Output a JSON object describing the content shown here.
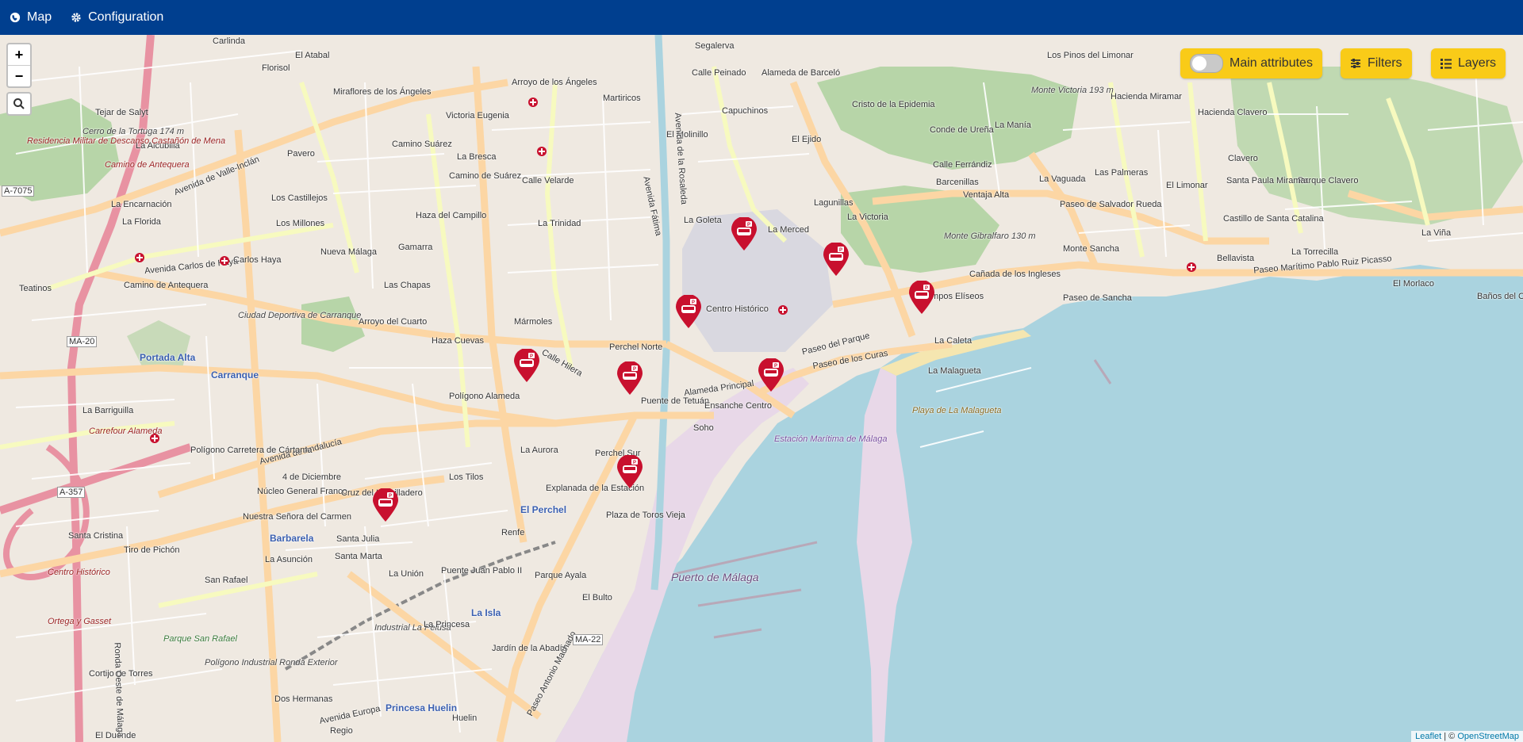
{
  "nav": {
    "map_label": "Map",
    "configuration_label": "Configuration"
  },
  "controls": {
    "main_attributes_label": "Main attributes",
    "filters_label": "Filters",
    "layers_label": "Layers",
    "zoom_in": "+",
    "zoom_out": "−"
  },
  "attribution": {
    "leaflet": "Leaflet",
    "separator": " | © ",
    "osm": "OpenStreetMap"
  },
  "colors": {
    "topbar": "#003f8f",
    "control_bg": "#f9cb18",
    "marker": "#c8102e",
    "sea": "#aad3df",
    "park": "#add19e"
  },
  "map_labels": {
    "carlinda": "Carlinda",
    "florisol": "Florisol",
    "el_atabal": "El Atabal",
    "miraflores": "Miraflores de los Ángeles",
    "arroyo_angeles": "Arroyo de los Ángeles",
    "martiricos": "Martiricos",
    "segalerva": "Segalerva",
    "calle_peinado": "Calle Peinado",
    "alameda_barcelo": "Alameda de Barceló",
    "los_pinos": "Los Pinos del Limonar",
    "monte_victoria": "Monte Victoria 193 m",
    "hacienda_miramar": "Hacienda Miramar",
    "hacienda_clavero": "Hacienda Clavero",
    "tejar_salyt": "Tejar de Salyt",
    "cerro_tortuga": "Cerro de la Tortuga 174 m",
    "la_alcubilla": "La Alcubilla",
    "pavero": "Pavero",
    "victoria_eugenia": "Victoria Eugenia",
    "la_bresca": "La Bresca",
    "el_molinillo": "El Molinillo",
    "capuchinos": "Capuchinos",
    "cristo_epidemia": "Cristo de la Epidemia",
    "conde_urena": "Conde de Ureña",
    "la_mania": "La Manía",
    "residencia_militar": "Residencia Militar de Descanso Castañón de Mena",
    "camino_antequera": "Camino de Antequera",
    "camino_suarez": "Camino Suárez",
    "el_ejido": "El Ejido",
    "calle_ferrandiz": "Calle Ferrándiz",
    "barcenillas": "Barcenillas",
    "la_vaguada": "La Vaguada",
    "las_palmeras": "Las Palmeras",
    "el_limonar": "El Limonar",
    "clavero": "Clavero",
    "parque_clavero": "Parque Clavero",
    "la_encarnacion": "La Encarnación",
    "los_castillejos": "Los Castillejos",
    "calle_velarde": "Calle Velarde",
    "lagunillas": "Lagunillas",
    "ventaja_alta": "Ventaja Alta",
    "paseo_salvador_rueda": "Paseo de Salvador Rueda",
    "santa_paula": "Santa Paula Miramar",
    "los_millones": "Los Millones",
    "haza_campillo": "Haza del Campillo",
    "la_trinidad": "La Trinidad",
    "la_goleta": "La Goleta",
    "la_merced": "La Merced",
    "la_victoria": "La Victoria",
    "monte_gibralfaro": "Monte Gibralfaro 130 m",
    "monte_sancha": "Monte Sancha",
    "castillo_santa_catalina": "Castillo de Santa Catalina",
    "la_torrecilla": "La Torrecilla",
    "la_vina": "La Viña",
    "la_florida": "La Florida",
    "avenida_carlos_haya": "Avenida Carlos de Haya",
    "carlos_haya": "Carlos Haya",
    "nueva_malaga": "Nueva Málaga",
    "gamarra": "Gamarra",
    "canada_ingleses": "Cañada de los Ingleses",
    "bellavista": "Bellavista",
    "paseo_maritimo_picasso": "Paseo Marítimo Pablo Ruiz Picasso",
    "el_morlaco": "El Morlaco",
    "banos_carmen": "Baños del Carmen",
    "teatinos": "Teatinos",
    "camino_antequera2": "Camino de Antequera",
    "las_chapas": "Las Chapas",
    "paseo_sancha": "Paseo de Sancha",
    "centro_historico": "Centro Histórico",
    "campos_eliseos": "Campos Elíseos",
    "ciudad_deportiva": "Ciudad Deportiva de Carranque",
    "arroyo_cuarto": "Arroyo del Cuarto",
    "marmoles": "Mármoles",
    "haza_cuevas": "Haza Cuevas",
    "perchel_norte": "Perchel Norte",
    "paseo_parque": "Paseo del Parque",
    "paseo_curas": "Paseo de los Curas",
    "la_caleta": "La Caleta",
    "la_malagueta": "La Malagueta",
    "portada_alta": "Portada Alta",
    "carranque": "Carranque",
    "poligono_alameda": "Polígono Alameda",
    "puente_tetuan": "Puente de Tetuán",
    "ensanche_centro": "Ensanche Centro",
    "soho": "Soho",
    "estacion_maritima": "Estación Marítima de Málaga",
    "playa_malagueta": "Playa de La Malagueta",
    "la_barriguilla": "La Barriguilla",
    "carrefour": "Carrefour Alameda",
    "avenida_andalucia": "Avenida de Andalucía",
    "la_aurora": "La Aurora",
    "perchel_sur": "Perchel Sur",
    "poligono_carretera": "Polígono Carretera de Cártama",
    "cuatro_diciembre": "4 de Diciembre",
    "los_tilos": "Los Tilos",
    "explanada_estacion": "Explanada de la Estación",
    "nucleo_general": "Núcleo General Franco",
    "cruz_humilladero": "Cruz del Humilladero",
    "el_perchel": "El Perchel",
    "plaza_toros": "Plaza de Toros Vieja",
    "nuestra_senora": "Nuestra Señora del Carmen",
    "barbarela": "Barbarela",
    "santa_julia": "Santa Julia",
    "renfe": "Renfe",
    "santa_cristina": "Santa Cristina",
    "tiro_pichon": "Tiro de Pichón",
    "santa_marta": "Santa Marta",
    "la_asuncion": "La Asunción",
    "la_union": "La Unión",
    "puente_juan_pablo": "Puente Juan Pablo II",
    "parque_ayala": "Parque Ayala",
    "el_bulto": "El Bulto",
    "puerto_malaga": "Puerto de Málaga",
    "centro_historico2": "Centro Histórico",
    "san_rafael": "San Rafael",
    "la_isla": "La Isla",
    "ortega_gasset": "Ortega y Gasset",
    "parque_san_rafael": "Parque San Rafael",
    "poligono_ronda": "Polígono Industrial Ronda Exterior",
    "industrial_pelusa": "Industrial La Pelusa",
    "la_princesa": "La Princesa",
    "jardin_abadia": "Jardín de la Abadía",
    "cortijo_torres": "Cortijo de Torres",
    "dos_hermanas": "Dos Hermanas",
    "princesa_huelin": "Princesa Huelin",
    "huelin": "Huelin",
    "el_duende": "El Duende",
    "regio": "Regio",
    "avenida_europa": "Avenida Europa",
    "paseo_antonio_machado": "Paseo Antonio Machado",
    "ma20": "MA-20",
    "ma22": "MA-22",
    "a357": "A-357",
    "a7075": "A-7075",
    "avenida_valle_inclan": "Avenida de Valle-Inclán",
    "avenida_rosaleda": "Avenida de la Rosaleda",
    "avenida_fatima": "Avenida Fátima",
    "camino_suarez2": "Camino de Suárez",
    "alameda_principal": "Alameda Principal",
    "calle_hilera": "Calle Hilera",
    "ronda_oeste": "Ronda Oeste de Málaga"
  }
}
